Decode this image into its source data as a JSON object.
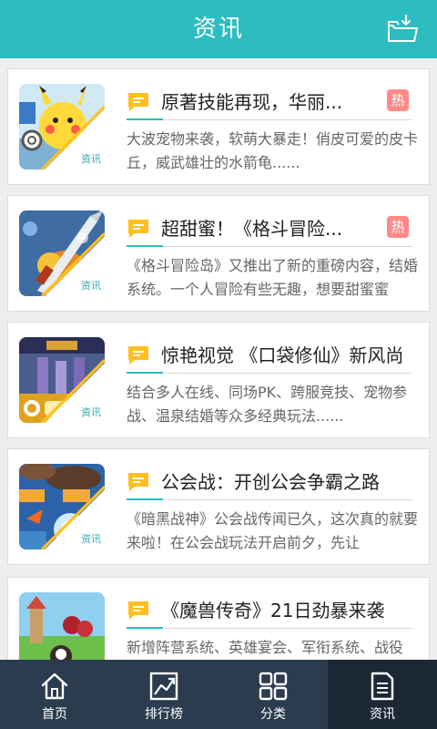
{
  "header": {
    "title": "资讯",
    "folder_icon": "folder-download-icon"
  },
  "thumb_badge": "资讯",
  "articles": [
    {
      "title": "原著技能再现，华丽...",
      "hot": "热",
      "desc": "大波宠物来袭，软萌大暴走！俏皮可爱的皮卡丘，威武雄壮的水箭龟......"
    },
    {
      "title": "超甜蜜！《格斗冒险...",
      "hot": "热",
      "desc": "《格斗冒险岛》又推出了新的重磅内容，结婚系统。一个人冒险有些无趣，想要甜蜜蜜"
    },
    {
      "title": "惊艳视觉 《口袋修仙》新风尚",
      "desc": "结合多人在线、同场PK、跨服竞技、宠物参战、温泉结婚等众多经典玩法......"
    },
    {
      "title": "公会战：开创公会争霸之路",
      "desc": "《暗黑战神》公会战传闻已久，这次真的就要来啦！在公会战玩法开启前夕，先让"
    },
    {
      "title": "《魔兽传奇》21日劲暴来袭",
      "desc": "新增阵营系统、英雄宴会、军衔系统、战役"
    }
  ],
  "tabs": [
    {
      "label": "首页",
      "icon": "home-icon"
    },
    {
      "label": "排行榜",
      "icon": "ranking-chart-icon"
    },
    {
      "label": "分类",
      "icon": "category-grid-icon"
    },
    {
      "label": "资讯",
      "icon": "news-document-icon",
      "active": true
    }
  ]
}
